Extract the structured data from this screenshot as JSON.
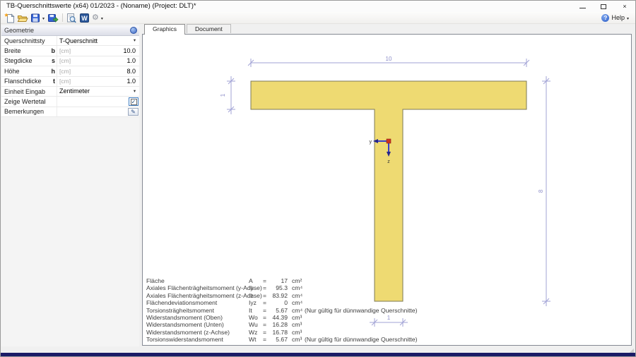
{
  "titlebar": {
    "title": "TB-Querschnittswerte (x64) 01/2023 - (Noname) (Project: DLT)*"
  },
  "glyphs": {
    "caret": "▾",
    "check": "✓",
    "gear": "⚙",
    "pencil": "✎",
    "help_q": "?",
    "word_w": "W",
    "close": "×"
  },
  "toolbar": {
    "help_label": "Help",
    "icons": [
      "new-document",
      "open-folder",
      "save",
      "export-save",
      "print-preview",
      "word-export",
      "settings-gear"
    ]
  },
  "geometrie": {
    "header": "Geometrie",
    "rows": [
      {
        "label": "Querschnittstyp",
        "value": "T-Querschnitt",
        "control": "dropdown"
      },
      {
        "label": "Breite",
        "symbol": "b",
        "hint": "[cm]",
        "value": "10.0"
      },
      {
        "label": "Stegdicke",
        "symbol": "s",
        "hint": "[cm]",
        "value": "1.0"
      },
      {
        "label": "Höhe",
        "symbol": "h",
        "hint": "[cm]",
        "value": "8.0"
      },
      {
        "label": "Flanschdicke",
        "symbol": "t",
        "hint": "[cm]",
        "value": "1.0"
      },
      {
        "label": "Einheit Eingabe",
        "value": "Zentimeter",
        "control": "dropdown"
      },
      {
        "label": "Zeige Wertetabelle",
        "control": "checkbox",
        "checked": true
      },
      {
        "label": "Bemerkungen",
        "control": "edit-button"
      }
    ]
  },
  "tabs": [
    {
      "label": "Graphics",
      "active": true
    },
    {
      "label": "Document",
      "active": false
    }
  ],
  "drawing": {
    "dim_width": "10",
    "dim_flange_thickness": "1",
    "dim_height": "8",
    "dim_web_thickness": "1",
    "axis_y": "y",
    "axis_z": "z",
    "shape_fill": "#eeda72",
    "shape_stroke": "#7d7a55",
    "dimension_color": "#a2a3d6",
    "dimension_text_color": "#8d8ec9",
    "axis_color": "#3c3cc8",
    "centroid_color": "#cc3322"
  },
  "results": {
    "eq": "=",
    "rows": [
      {
        "label": "Fläche",
        "symbol": "A",
        "value": "17",
        "unit": "cm²",
        "note": ""
      },
      {
        "label": "Axiales Flächenträgheitsmoment (y-Achse)",
        "symbol": "Iy",
        "value": "95.3",
        "unit": "cm⁴",
        "note": ""
      },
      {
        "label": "Axiales Flächenträgheitsmoment (z-Achse)",
        "symbol": "Iz",
        "value": "83.92",
        "unit": "cm⁴",
        "note": ""
      },
      {
        "label": "Flächendeviationsmoment",
        "symbol": "Iyz",
        "value": "0",
        "unit": "cm⁴",
        "note": ""
      },
      {
        "label": "Torsionsträgheitsmoment",
        "symbol": "It",
        "value": "5.67",
        "unit": "cm⁴",
        "note": "(Nur gültig für dünnwandige Querschnitte)"
      },
      {
        "label": "Widerstandsmoment (Oben)",
        "symbol": "Wo",
        "value": "44.39",
        "unit": "cm³",
        "note": ""
      },
      {
        "label": "Widerstandsmoment (Unten)",
        "symbol": "Wu",
        "value": "16.28",
        "unit": "cm³",
        "note": ""
      },
      {
        "label": "Widerstandsmoment (z-Achse)",
        "symbol": "Wz",
        "value": "16.78",
        "unit": "cm³",
        "note": ""
      },
      {
        "label": "Torsionswiderstandsmoment",
        "symbol": "Wt",
        "value": "5.67",
        "unit": "cm³",
        "note": "(Nur gültig für dünnwandige Querschnitte)"
      }
    ]
  }
}
